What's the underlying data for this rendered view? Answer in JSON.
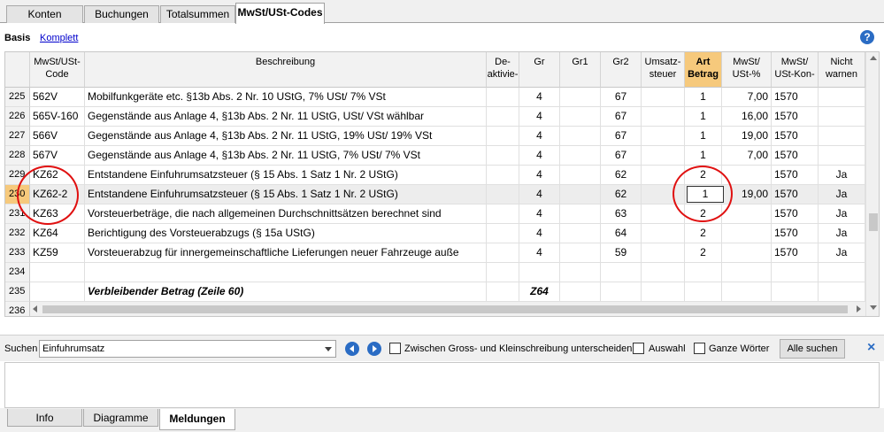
{
  "tabs": [
    "Konten",
    "Buchungen",
    "Totalsummen",
    "MwSt/USt-Codes"
  ],
  "viewbar": {
    "basis": "Basis",
    "komplett": "Komplett",
    "help": "?"
  },
  "columns": {
    "code": [
      "MwSt/USt-",
      "Code"
    ],
    "beschreibung": "Beschreibung",
    "deaktiviert": [
      "De-",
      "aktivie-"
    ],
    "gr": "Gr",
    "gr1": "Gr1",
    "gr2": "Gr2",
    "umsatzsteuer": [
      "Umsatz-",
      "steuer"
    ],
    "artbetrag": [
      "Art",
      "Betrag"
    ],
    "mwst_pct": [
      "MwSt/",
      "USt-%"
    ],
    "mwst_kon": [
      "MwSt/",
      "USt-Kon-"
    ],
    "nichtwarnen": [
      "Nicht",
      "warnen"
    ]
  },
  "rows": [
    {
      "n": "225",
      "code": "562V",
      "desc": "Mobilfunkgeräte etc. §13b Abs. 2 Nr. 10 UStG, 7% USt/ 7% VSt",
      "gr": "4",
      "gr2": "67",
      "art": "1",
      "pct": "7,00",
      "kon": "1570",
      "warn": ""
    },
    {
      "n": "226",
      "code": "565V-160",
      "desc": "Gegenstände aus Anlage 4, §13b Abs. 2 Nr. 11 UStG, USt/ VSt wählbar",
      "gr": "4",
      "gr2": "67",
      "art": "1",
      "pct": "16,00",
      "kon": "1570",
      "warn": ""
    },
    {
      "n": "227",
      "code": "566V",
      "desc": "Gegenstände aus Anlage 4, §13b Abs. 2 Nr. 11 UStG, 19% USt/ 19% VSt",
      "gr": "4",
      "gr2": "67",
      "art": "1",
      "pct": "19,00",
      "kon": "1570",
      "warn": ""
    },
    {
      "n": "228",
      "code": "567V",
      "desc": "Gegenstände aus Anlage 4, §13b Abs. 2 Nr. 11 UStG, 7% USt/ 7% VSt",
      "gr": "4",
      "gr2": "67",
      "art": "1",
      "pct": "7,00",
      "kon": "1570",
      "warn": ""
    },
    {
      "n": "229",
      "code": "KZ62",
      "desc": "Entstandene Einfuhrumsatzsteuer (§ 15 Abs. 1 Satz 1 Nr. 2 UStG)",
      "gr": "4",
      "gr2": "62",
      "art": "2",
      "pct": "",
      "kon": "1570",
      "warn": "Ja"
    },
    {
      "n": "230",
      "code": "KZ62-2",
      "desc": "Entstandene Einfuhrumsatzsteuer (§ 15 Abs. 1 Satz 1 Nr. 2 UStG)",
      "gr": "4",
      "gr2": "62",
      "art": "1",
      "pct": "19,00",
      "kon": "1570",
      "warn": "Ja"
    },
    {
      "n": "231",
      "code": "KZ63",
      "desc": "Vorsteuerbeträge, die nach allgemeinen Durchschnittsätzen berechnet sind",
      "gr": "4",
      "gr2": "63",
      "art": "2",
      "pct": "",
      "kon": "1570",
      "warn": "Ja"
    },
    {
      "n": "232",
      "code": "KZ64",
      "desc": "Berichtigung des Vorsteuerabzugs (§ 15a UStG)",
      "gr": "4",
      "gr2": "64",
      "art": "2",
      "pct": "",
      "kon": "1570",
      "warn": "Ja"
    },
    {
      "n": "233",
      "code": "KZ59",
      "desc": "Vorsteuerabzug für innergemeinschaftliche Lieferungen neuer Fahrzeuge auße",
      "gr": "4",
      "gr2": "59",
      "art": "2",
      "pct": "",
      "kon": "1570",
      "warn": "Ja"
    },
    {
      "n": "234",
      "code": "",
      "desc": "",
      "gr": "",
      "gr2": "",
      "art": "",
      "pct": "",
      "kon": "",
      "warn": ""
    },
    {
      "n": "235",
      "code": "",
      "desc": "Verbleibender Betrag (Zeile 60)",
      "gr": "Z64",
      "gr2": "",
      "art": "",
      "pct": "",
      "kon": "",
      "warn": ""
    },
    {
      "n": "236",
      "code": "",
      "desc": "",
      "gr": "",
      "gr2": "",
      "art": "",
      "pct": "",
      "kon": "",
      "warn": ""
    }
  ],
  "search": {
    "label": "Suchen",
    "value": "Einfuhrumsatz",
    "case_label": "Zwischen Gross- und Kleinschreibung unterscheiden",
    "auswahl_label": "Auswahl",
    "words_label": "Ganze Wörter",
    "find_all": "Alle suchen",
    "close": "×"
  },
  "bottom_tabs": [
    "Info",
    "Diagramme",
    "Meldungen"
  ],
  "colors": {
    "highlight": "#f6c97c",
    "annotation": "#e01010",
    "accent": "#2a6cc4"
  }
}
